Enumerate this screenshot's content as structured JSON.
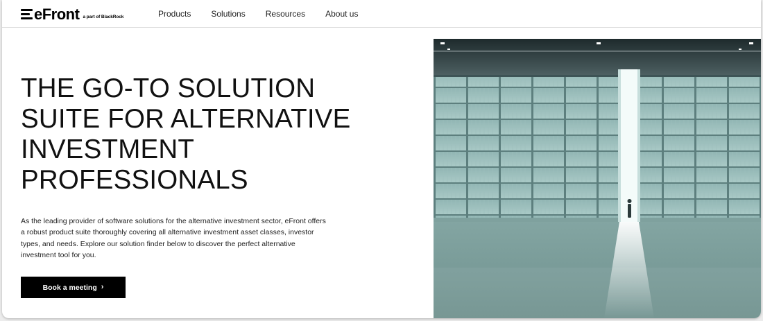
{
  "brand": {
    "name": "eFront",
    "tagline": "a part of BlackRock"
  },
  "nav": {
    "items": [
      "Products",
      "Solutions",
      "Resources",
      "About us"
    ]
  },
  "hero": {
    "headline_lines": [
      "THE GO-TO SOLUTION",
      "SUITE FOR ALTERNATIVE",
      "INVESTMENT",
      "PROFESSIONALS"
    ],
    "body_lines": [
      "As the leading provider of software solutions for the alternative investment sector, eFront offers",
      "a robust product suite thoroughly covering all alternative investment asset classes, investor",
      "types, and needs. Explore our solution finder below to discover the perfect alternative",
      "investment tool for you."
    ],
    "cta_label": "Book a meeting",
    "cta_icon": "chevron-right-icon",
    "image_subject": "hangar-doorway-with-person"
  },
  "colors": {
    "text": "#111111",
    "cta_bg": "#000000",
    "cta_text": "#ffffff",
    "header_border": "#dcdcdc"
  }
}
